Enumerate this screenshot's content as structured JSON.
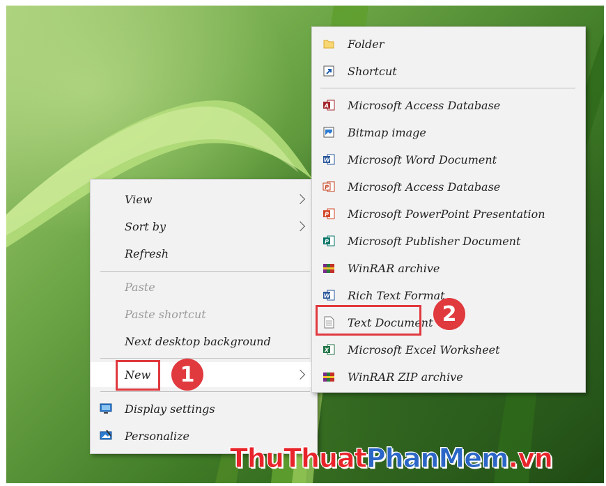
{
  "context_menu": {
    "items": [
      {
        "label": "View",
        "submenu": true,
        "enabled": true
      },
      {
        "label": "Sort by",
        "submenu": true,
        "enabled": true
      },
      {
        "label": "Refresh",
        "submenu": false,
        "enabled": true
      },
      {
        "label": "Paste",
        "submenu": false,
        "enabled": false
      },
      {
        "label": "Paste shortcut",
        "submenu": false,
        "enabled": false
      },
      {
        "label": "Next desktop background",
        "submenu": false,
        "enabled": true
      },
      {
        "label": "New",
        "submenu": true,
        "enabled": true,
        "highlighted": true
      },
      {
        "label": "Display settings",
        "icon": "display-settings-icon",
        "enabled": true
      },
      {
        "label": "Personalize",
        "icon": "personalize-icon",
        "enabled": true
      }
    ]
  },
  "new_submenu": {
    "items": [
      {
        "label": "Folder",
        "icon": "folder-icon"
      },
      {
        "label": "Shortcut",
        "icon": "shortcut-icon"
      },
      {
        "label": "Microsoft Access Database",
        "icon": "access-icon"
      },
      {
        "label": "Bitmap image",
        "icon": "bitmap-icon"
      },
      {
        "label": "Microsoft Word Document",
        "icon": "word-icon"
      },
      {
        "label": "Microsoft Access Database",
        "icon": "access-alt-icon"
      },
      {
        "label": "Microsoft PowerPoint Presentation",
        "icon": "powerpoint-icon"
      },
      {
        "label": "Microsoft Publisher Document",
        "icon": "publisher-icon"
      },
      {
        "label": "WinRAR archive",
        "icon": "winrar-icon"
      },
      {
        "label": "Rich Text Format",
        "icon": "rtf-icon"
      },
      {
        "label": "Text Document",
        "icon": "text-document-icon"
      },
      {
        "label": "Microsoft Excel Worksheet",
        "icon": "excel-icon"
      },
      {
        "label": "WinRAR ZIP archive",
        "icon": "winrar-zip-icon"
      }
    ]
  },
  "annotations": {
    "step1": "1",
    "step2": "2",
    "accent_color": "#e0393e"
  },
  "watermark": {
    "text_thu": "ThuThuat",
    "text_phan": "PhanMem",
    "text_vn": ".vn"
  }
}
